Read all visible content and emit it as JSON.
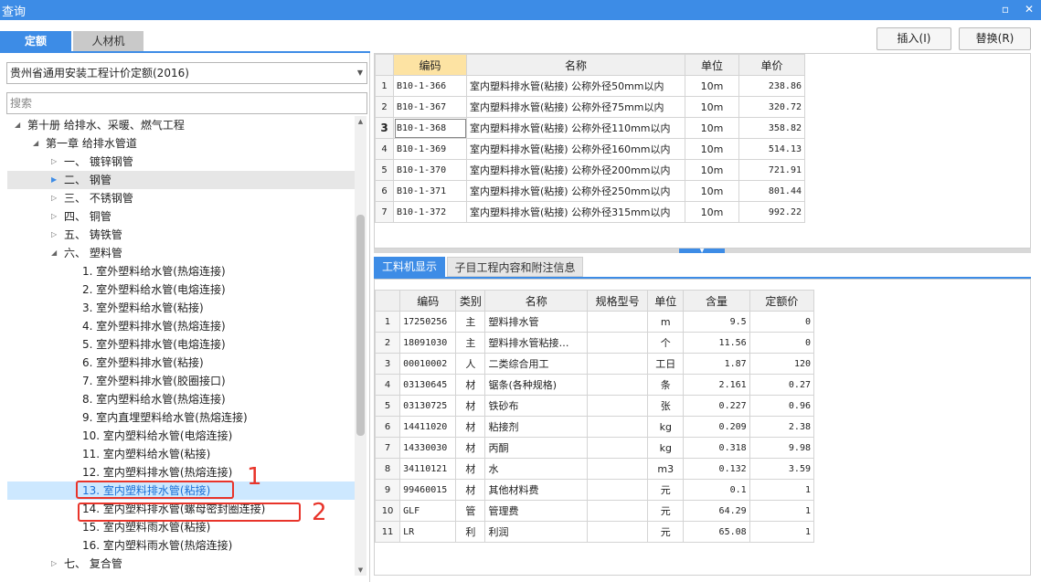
{
  "window": {
    "title": "查询",
    "maximize_glyph": "▫",
    "close_glyph": "✕"
  },
  "tabs": [
    {
      "label": "定额"
    },
    {
      "label": "人材机"
    }
  ],
  "toolbar": {
    "insert_label": "插入(I)",
    "replace_label": "替换(R)"
  },
  "quota_select": {
    "value": "贵州省通用安装工程计价定额(2016)"
  },
  "search": {
    "placeholder": "搜索"
  },
  "tree": [
    {
      "label": "第十册  给排水、采暖、燃气工程",
      "twisty": "◢"
    },
    {
      "label": "第一章  给排水管道",
      "twisty": "◢"
    },
    {
      "label": "一、  镀锌钢管",
      "twisty": "▷"
    },
    {
      "label": "二、  钢管",
      "twisty": "▶"
    },
    {
      "label": "三、  不锈钢管",
      "twisty": "▷"
    },
    {
      "label": "四、  铜管",
      "twisty": "▷"
    },
    {
      "label": "五、  铸铁管",
      "twisty": "▷"
    },
    {
      "label": "六、  塑料管",
      "twisty": "◢"
    },
    {
      "label": "1.  室外塑料给水管(热熔连接)"
    },
    {
      "label": "2.  室外塑料给水管(电熔连接)"
    },
    {
      "label": "3.  室外塑料给水管(粘接)"
    },
    {
      "label": "4.  室外塑料排水管(热熔连接)"
    },
    {
      "label": "5.  室外塑料排水管(电熔连接)"
    },
    {
      "label": "6.  室外塑料排水管(粘接)"
    },
    {
      "label": "7.  室外塑料排水管(胶圈接口)"
    },
    {
      "label": "8.  室内塑料给水管(热熔连接)"
    },
    {
      "label": "9.  室内直埋塑料给水管(热熔连接)"
    },
    {
      "label": "10.  室内塑料给水管(电熔连接)"
    },
    {
      "label": "11.  室内塑料给水管(粘接)"
    },
    {
      "label": "12.  室内塑料排水管(热熔连接)"
    },
    {
      "label": "13.  室内塑料排水管(粘接)"
    },
    {
      "label": "14.  室内塑料排水管(螺母密封圈连接)"
    },
    {
      "label": "15.  室内塑料雨水管(粘接)"
    },
    {
      "label": "16.  室内塑料雨水管(热熔连接)"
    },
    {
      "label": "七、  复合管",
      "twisty": "▷"
    }
  ],
  "scrollbar": {
    "up": "▲",
    "down": "▼"
  },
  "top_grid": {
    "headers": [
      "编码",
      "名称",
      "单位",
      "单价"
    ],
    "rows": [
      {
        "idx": "1",
        "code": "B10-1-366",
        "name": "室内塑料排水管(粘接) 公称外径50mm以内",
        "unit": "10m",
        "price": "238.86"
      },
      {
        "idx": "2",
        "code": "B10-1-367",
        "name": "室内塑料排水管(粘接) 公称外径75mm以内",
        "unit": "10m",
        "price": "320.72"
      },
      {
        "idx": "3",
        "code": "B10-1-368",
        "name": "室内塑料排水管(粘接) 公称外径110mm以内",
        "unit": "10m",
        "price": "358.82"
      },
      {
        "idx": "4",
        "code": "B10-1-369",
        "name": "室内塑料排水管(粘接) 公称外径160mm以内",
        "unit": "10m",
        "price": "514.13"
      },
      {
        "idx": "5",
        "code": "B10-1-370",
        "name": "室内塑料排水管(粘接) 公称外径200mm以内",
        "unit": "10m",
        "price": "721.91"
      },
      {
        "idx": "6",
        "code": "B10-1-371",
        "name": "室内塑料排水管(粘接) 公称外径250mm以内",
        "unit": "10m",
        "price": "801.44"
      },
      {
        "idx": "7",
        "code": "B10-1-372",
        "name": "室内塑料排水管(粘接) 公称外径315mm以内",
        "unit": "10m",
        "price": "992.22"
      }
    ]
  },
  "splitter": {
    "grip": "▼"
  },
  "bottom_tabs": [
    {
      "label": "工料机显示"
    },
    {
      "label": "子目工程内容和附注信息"
    }
  ],
  "bottom_grid": {
    "headers": [
      "编码",
      "类别",
      "名称",
      "规格型号",
      "单位",
      "含量",
      "定额价"
    ],
    "rows": [
      {
        "idx": "1",
        "code": "17250256",
        "type": "主",
        "name": "塑料排水管",
        "spec": "",
        "unit": "m",
        "qty": "9.5",
        "price": "0"
      },
      {
        "idx": "2",
        "code": "18091030",
        "type": "主",
        "name": "塑料排水管粘接…",
        "spec": "",
        "unit": "个",
        "qty": "11.56",
        "price": "0"
      },
      {
        "idx": "3",
        "code": "00010002",
        "type": "人",
        "name": "二类综合用工",
        "spec": "",
        "unit": "工日",
        "qty": "1.87",
        "price": "120"
      },
      {
        "idx": "4",
        "code": "03130645",
        "type": "材",
        "name": "锯条(各种规格)",
        "spec": "",
        "unit": "条",
        "qty": "2.161",
        "price": "0.27"
      },
      {
        "idx": "5",
        "code": "03130725",
        "type": "材",
        "name": "铁砂布",
        "spec": "",
        "unit": "张",
        "qty": "0.227",
        "price": "0.96"
      },
      {
        "idx": "6",
        "code": "14411020",
        "type": "材",
        "name": "粘接剂",
        "spec": "",
        "unit": "kg",
        "qty": "0.209",
        "price": "2.38"
      },
      {
        "idx": "7",
        "code": "14330030",
        "type": "材",
        "name": "丙酮",
        "spec": "",
        "unit": "kg",
        "qty": "0.318",
        "price": "9.98"
      },
      {
        "idx": "8",
        "code": "34110121",
        "type": "材",
        "name": "水",
        "spec": "",
        "unit": "m3",
        "qty": "0.132",
        "price": "3.59"
      },
      {
        "idx": "9",
        "code": "99460015",
        "type": "材",
        "name": "其他材料费",
        "spec": "",
        "unit": "元",
        "qty": "0.1",
        "price": "1"
      },
      {
        "idx": "10",
        "code": "GLF",
        "type": "管",
        "name": "管理费",
        "spec": "",
        "unit": "元",
        "qty": "64.29",
        "price": "1"
      },
      {
        "idx": "11",
        "code": "LR",
        "type": "利",
        "name": "利润",
        "spec": "",
        "unit": "元",
        "qty": "65.08",
        "price": "1"
      }
    ]
  },
  "annotations": {
    "num1": "1",
    "num2": "2",
    "color": "#e8342a"
  },
  "colors": {
    "accent": "#3d8ce6",
    "header_highlight": "#fde3a3",
    "tree_highlight": "#cde8ff"
  }
}
